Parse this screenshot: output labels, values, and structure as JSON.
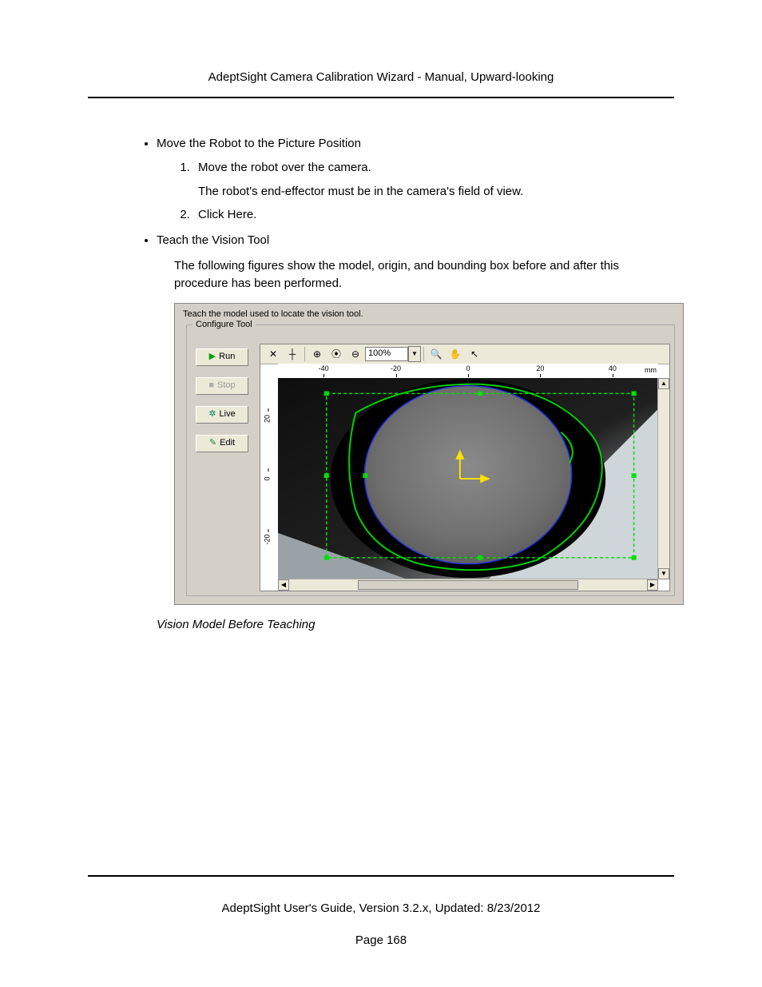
{
  "header": "AdeptSight Camera Calibration Wizard - Manual, Upward-looking",
  "section1": {
    "title": "Move the Robot to the Picture Position",
    "steps": [
      {
        "text": "Move the robot over the camera.",
        "sub": "The robot's end-effector must be in the camera's field of view."
      },
      {
        "text": "Click Here."
      }
    ]
  },
  "section2": {
    "title": "Teach the Vision Tool",
    "para": "The following figures show the model, origin, and bounding box before and after this procedure has been performed."
  },
  "shot": {
    "instruction": "Teach the model used to locate the vision tool.",
    "group_label": "Configure Tool",
    "buttons": {
      "run": "Run",
      "stop": "Stop",
      "live": "Live",
      "edit": "Edit"
    },
    "toolbar": {
      "zoom_value": "100%"
    },
    "ruler_x": {
      "ticks": [
        "-40",
        "-20",
        "0",
        "20",
        "40"
      ],
      "unit": "mm"
    },
    "ruler_y": {
      "ticks": [
        "20",
        "0",
        "-20"
      ]
    }
  },
  "caption": "Vision Model Before Teaching",
  "footer_line": "AdeptSight User's Guide,  Version 3.2.x, Updated: 8/23/2012",
  "page_number": "Page 168"
}
